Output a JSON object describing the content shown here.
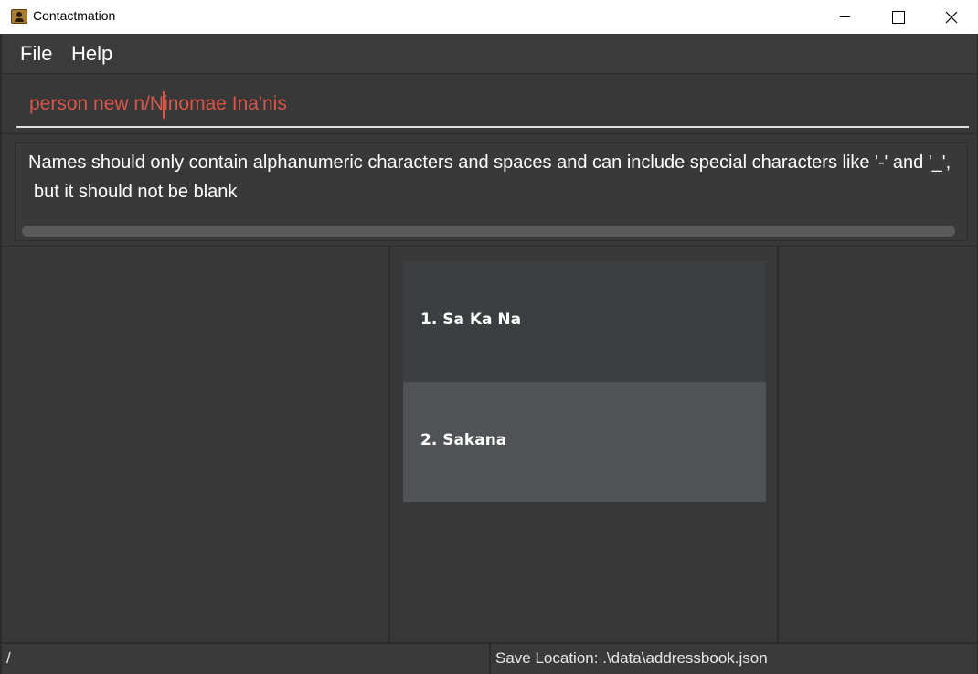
{
  "window": {
    "title": "Contactmation"
  },
  "menu": {
    "file_label": "File",
    "help_label": "Help"
  },
  "command_box": {
    "value": "person new n/Ninomae Ina'nis",
    "text_color": "#d8564a"
  },
  "result_display": {
    "line_1": "Names should only contain alphanumeric characters and spaces and can include special characters like '-' and '_',",
    "line_2": "but it should not be blank"
  },
  "contact_list": {
    "items": [
      {
        "label": "1.  Sa Ka Na",
        "selected": false
      },
      {
        "label": "2.  Sakana",
        "selected": true
      }
    ]
  },
  "status_bar": {
    "path": "/",
    "save_location": "Save Location: .\\data\\addressbook.json"
  },
  "colors": {
    "background": "#383838",
    "selected_item": "#4f5356",
    "item": "#3c3e40"
  }
}
